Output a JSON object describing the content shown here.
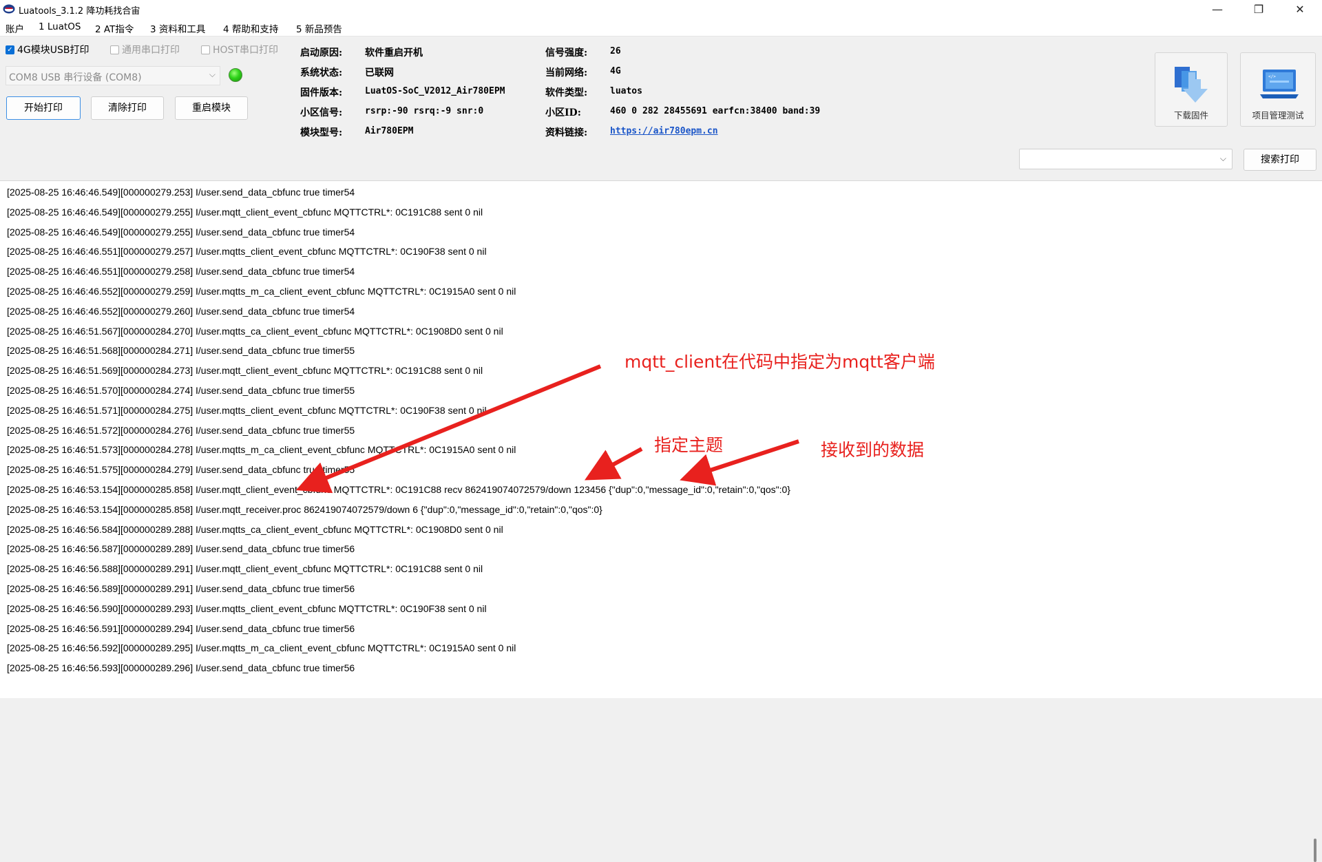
{
  "window": {
    "title": "Luatools_3.1.2 降功耗找合宙",
    "controls": [
      "—",
      "❐",
      "✕"
    ]
  },
  "menu": [
    "账户",
    "1 LuatOS",
    "2 AT指令",
    "3 资料和工具",
    "4 帮助和支持",
    "5 新品预告"
  ],
  "print_options": [
    {
      "label": "4G模块USB打印",
      "checked": true,
      "enabled": true
    },
    {
      "label": "通用串口打印",
      "checked": false,
      "enabled": false
    },
    {
      "label": "HOST串口打印",
      "checked": false,
      "enabled": false
    }
  ],
  "port_select": {
    "value": "COM8 USB 串行设备 (COM8)"
  },
  "status_led": {
    "color": "#2fd31a"
  },
  "buttons": {
    "start": "开始打印",
    "clear": "清除打印",
    "restart": "重启模块"
  },
  "info_left": [
    {
      "label": "启动原因:",
      "value": "软件重启开机"
    },
    {
      "label": "系统状态:",
      "value": "已联网"
    },
    {
      "label": "固件版本:",
      "value": "LuatOS-SoC_V2012_Air780EPM"
    },
    {
      "label": "小区信号:",
      "value": "rsrp:-90 rsrq:-9 snr:0"
    },
    {
      "label": "模块型号:",
      "value": "Air780EPM"
    }
  ],
  "info_right": [
    {
      "label": "信号强度:",
      "value": "26"
    },
    {
      "label": "当前网络:",
      "value": "4G"
    },
    {
      "label": "软件类型:",
      "value": "luatos"
    },
    {
      "label": "小区ID:",
      "value": "460 0 282 28455691 earfcn:38400 band:39"
    },
    {
      "label": "资料链接:",
      "value": "https://air780epm.cn"
    }
  ],
  "tools": {
    "download": "下载固件",
    "project": "项目管理测试"
  },
  "search": {
    "value": "",
    "button": "搜索打印"
  },
  "log_lines": [
    "[2025-08-25 16:46:46.549][000000279.253] I/user.send_data_cbfunc true timer54",
    "[2025-08-25 16:46:46.549][000000279.255] I/user.mqtt_client_event_cbfunc MQTTCTRL*: 0C191C88 sent 0 nil",
    "[2025-08-25 16:46:46.549][000000279.255] I/user.send_data_cbfunc true timer54",
    "[2025-08-25 16:46:46.551][000000279.257] I/user.mqtts_client_event_cbfunc MQTTCTRL*: 0C190F38 sent 0 nil",
    "[2025-08-25 16:46:46.551][000000279.258] I/user.send_data_cbfunc true timer54",
    "[2025-08-25 16:46:46.552][000000279.259] I/user.mqtts_m_ca_client_event_cbfunc MQTTCTRL*: 0C1915A0 sent 0 nil",
    "[2025-08-25 16:46:46.552][000000279.260] I/user.send_data_cbfunc true timer54",
    "[2025-08-25 16:46:51.567][000000284.270] I/user.mqtts_ca_client_event_cbfunc MQTTCTRL*: 0C1908D0 sent 0 nil",
    "[2025-08-25 16:46:51.568][000000284.271] I/user.send_data_cbfunc true timer55",
    "[2025-08-25 16:46:51.569][000000284.273] I/user.mqtt_client_event_cbfunc MQTTCTRL*: 0C191C88 sent 0 nil",
    "[2025-08-25 16:46:51.570][000000284.274] I/user.send_data_cbfunc true timer55",
    "[2025-08-25 16:46:51.571][000000284.275] I/user.mqtts_client_event_cbfunc MQTTCTRL*: 0C190F38 sent 0 nil",
    "[2025-08-25 16:46:51.572][000000284.276] I/user.send_data_cbfunc true timer55",
    "[2025-08-25 16:46:51.573][000000284.278] I/user.mqtts_m_ca_client_event_cbfunc MQTTCTRL*: 0C1915A0 sent 0 nil",
    "[2025-08-25 16:46:51.575][000000284.279] I/user.send_data_cbfunc true timer55",
    "[2025-08-25 16:46:53.154][000000285.858] I/user.mqtt_client_event_cbfunc MQTTCTRL*: 0C191C88 recv 862419074072579/down 123456 {\"dup\":0,\"message_id\":0,\"retain\":0,\"qos\":0}",
    "[2025-08-25 16:46:53.154][000000285.858] I/user.mqtt_receiver.proc 862419074072579/down 6 {\"dup\":0,\"message_id\":0,\"retain\":0,\"qos\":0}",
    "[2025-08-25 16:46:56.584][000000289.288] I/user.mqtts_ca_client_event_cbfunc MQTTCTRL*: 0C1908D0 sent 0 nil",
    "[2025-08-25 16:46:56.587][000000289.289] I/user.send_data_cbfunc true timer56",
    "[2025-08-25 16:46:56.588][000000289.291] I/user.mqtt_client_event_cbfunc MQTTCTRL*: 0C191C88 sent 0 nil",
    "[2025-08-25 16:46:56.589][000000289.291] I/user.send_data_cbfunc true timer56",
    "[2025-08-25 16:46:56.590][000000289.293] I/user.mqtts_client_event_cbfunc MQTTCTRL*: 0C190F38 sent 0 nil",
    "[2025-08-25 16:46:56.591][000000289.294] I/user.send_data_cbfunc true timer56",
    "[2025-08-25 16:46:56.592][000000289.295] I/user.mqtts_m_ca_client_event_cbfunc MQTTCTRL*: 0C1915A0 sent 0 nil",
    "[2025-08-25 16:46:56.593][000000289.296] I/user.send_data_cbfunc true timer56"
  ],
  "annotations": {
    "client": "mqtt_client在代码中指定为mqtt客户端",
    "topic": "指定主题",
    "data": "接收到的数据",
    "color": "#e8211e"
  }
}
